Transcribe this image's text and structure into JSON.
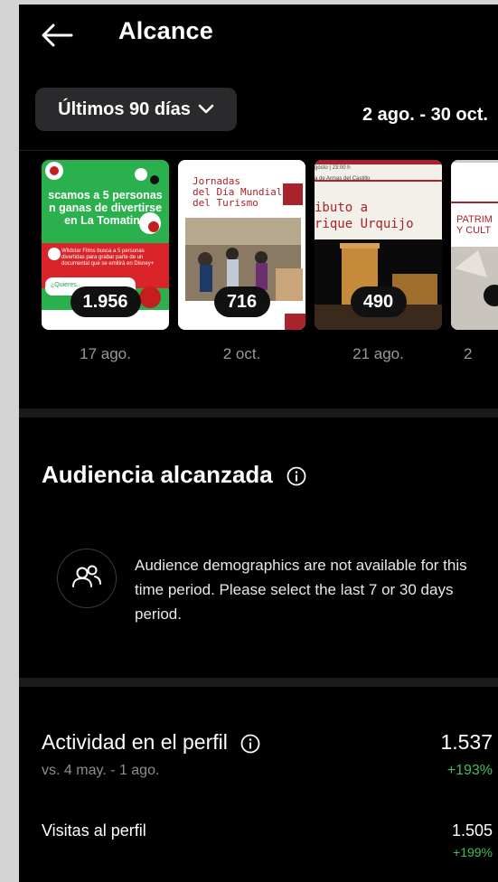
{
  "header": {
    "title": "Alcance"
  },
  "filter": {
    "range_label": "Últimos 90 días",
    "date_range": "2 ago. - 30 oct."
  },
  "posts": [
    {
      "count": "1.956",
      "date": "17 ago.",
      "text_lines": [
        "scamos a 5 personas",
        "n ganas de divertirse",
        "en La Tomatina"
      ],
      "small_text": "Wildstar Films busca a 5 personas divertidas para grabar parte de un documental que se emitirá en Disney+",
      "cta": "¿Quieres...",
      "bg_color": "#27a84a"
    },
    {
      "count": "716",
      "date": "2 oct.",
      "text_lines": [
        "Jornadas",
        "del Día Mundial",
        "del Turismo"
      ],
      "bg_color": "#ffffff"
    },
    {
      "count": "490",
      "date": "21 ago.",
      "top_text": [
        "gosto | 23:00 h",
        "a de Armas del Castillo"
      ],
      "text_lines": [
        "ibuto a",
        "rique Urquijo"
      ],
      "bg_color": "#f3efe9"
    },
    {
      "count": "",
      "date": "2",
      "text_lines": [
        "PATRIM",
        "Y CULT"
      ],
      "bg_color": "#ffffff"
    }
  ],
  "audience": {
    "title": "Audiencia alcanzada",
    "message": "Audience demographics are not available for this time period. Please select the last 7 or 30 days period."
  },
  "activity": {
    "title": "Actividad en el perfil",
    "comparison": "vs. 4 may. - 1 ago.",
    "value": "1.537",
    "delta": "+193%",
    "rows": [
      {
        "label": "Visitas al perfil",
        "value": "1.505",
        "delta": "+199%"
      }
    ]
  },
  "colors": {
    "background": "#000000",
    "positive": "#3fbf5f",
    "muted": "#8e8e8e"
  }
}
